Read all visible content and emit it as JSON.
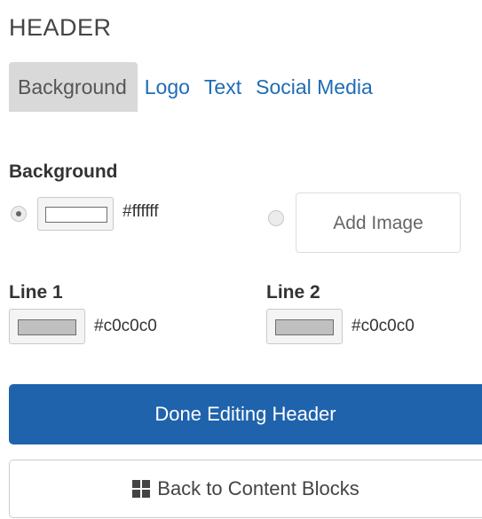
{
  "header": {
    "title": "HEADER"
  },
  "tabs": [
    {
      "label": "Background",
      "active": true
    },
    {
      "label": "Logo",
      "active": false
    },
    {
      "label": "Text",
      "active": false
    },
    {
      "label": "Social Media",
      "active": false
    }
  ],
  "background": {
    "label": "Background",
    "color_option": {
      "selected": true,
      "swatch_color": "#ffffff",
      "hex": "#ffffff"
    },
    "image_option": {
      "selected": false,
      "button_label": "Add Image"
    }
  },
  "line1": {
    "label": "Line 1",
    "swatch_color": "#c0c0c0",
    "hex": "#c0c0c0"
  },
  "line2": {
    "label": "Line 2",
    "swatch_color": "#c0c0c0",
    "hex": "#c0c0c0"
  },
  "buttons": {
    "done_label": "Done Editing Header",
    "done_color": "#1f63ad",
    "back_label": "Back to Content Blocks",
    "back_icon": "grid-icon"
  }
}
